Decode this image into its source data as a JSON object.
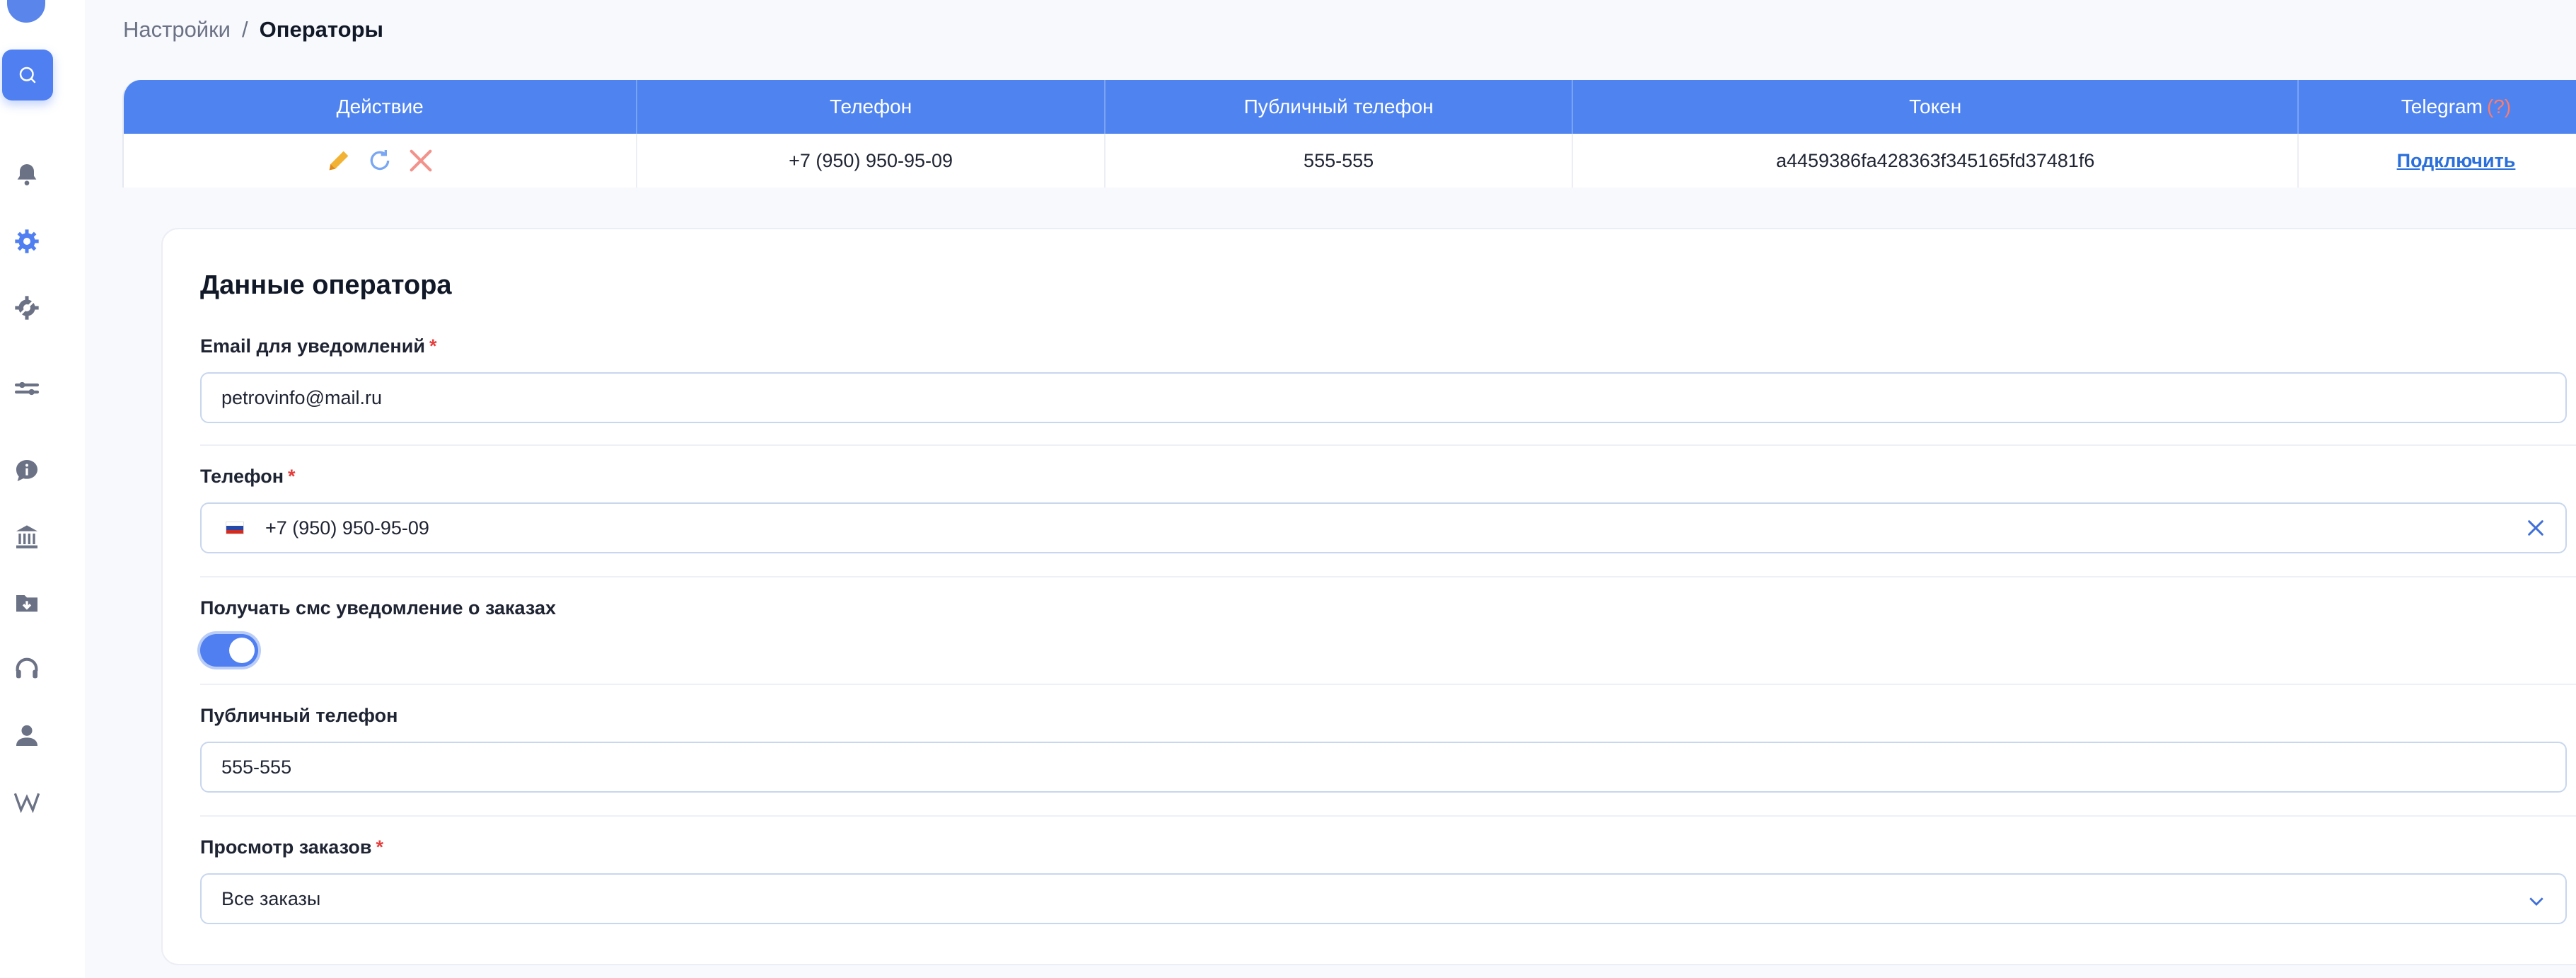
{
  "breadcrumb": {
    "root": "Настройки",
    "separator": "/",
    "current": "Операторы"
  },
  "table": {
    "headers": {
      "action": "Действие",
      "phone": "Телефон",
      "public_phone": "Публичный телефон",
      "token": "Токен",
      "telegram": "Telegram",
      "telegram_hint": "(?)"
    },
    "row": {
      "phone": "+7 (950) 950-95-09",
      "public_phone": "555-555",
      "token": "a4459386fa428363f345165fd37481f6",
      "telegram_link": "Подключить"
    }
  },
  "form": {
    "title": "Данные оператора",
    "email": {
      "label": "Email для уведомлений",
      "required_mark": "*",
      "value": "petrovinfo@mail.ru"
    },
    "phone": {
      "label": "Телефон",
      "required_mark": "*",
      "value": "+7 (950) 950-95-09"
    },
    "sms": {
      "label": "Получать смс уведомление о заказах",
      "enabled": true
    },
    "public_phone": {
      "label": "Публичный телефон",
      "value": "555-555"
    },
    "orders_view": {
      "label": "Просмотр заказов",
      "required_mark": "*",
      "value": "Все заказы"
    }
  },
  "colors": {
    "accent": "#4f84f0",
    "required": "#e53e3e",
    "link": "#2a6fdb"
  }
}
